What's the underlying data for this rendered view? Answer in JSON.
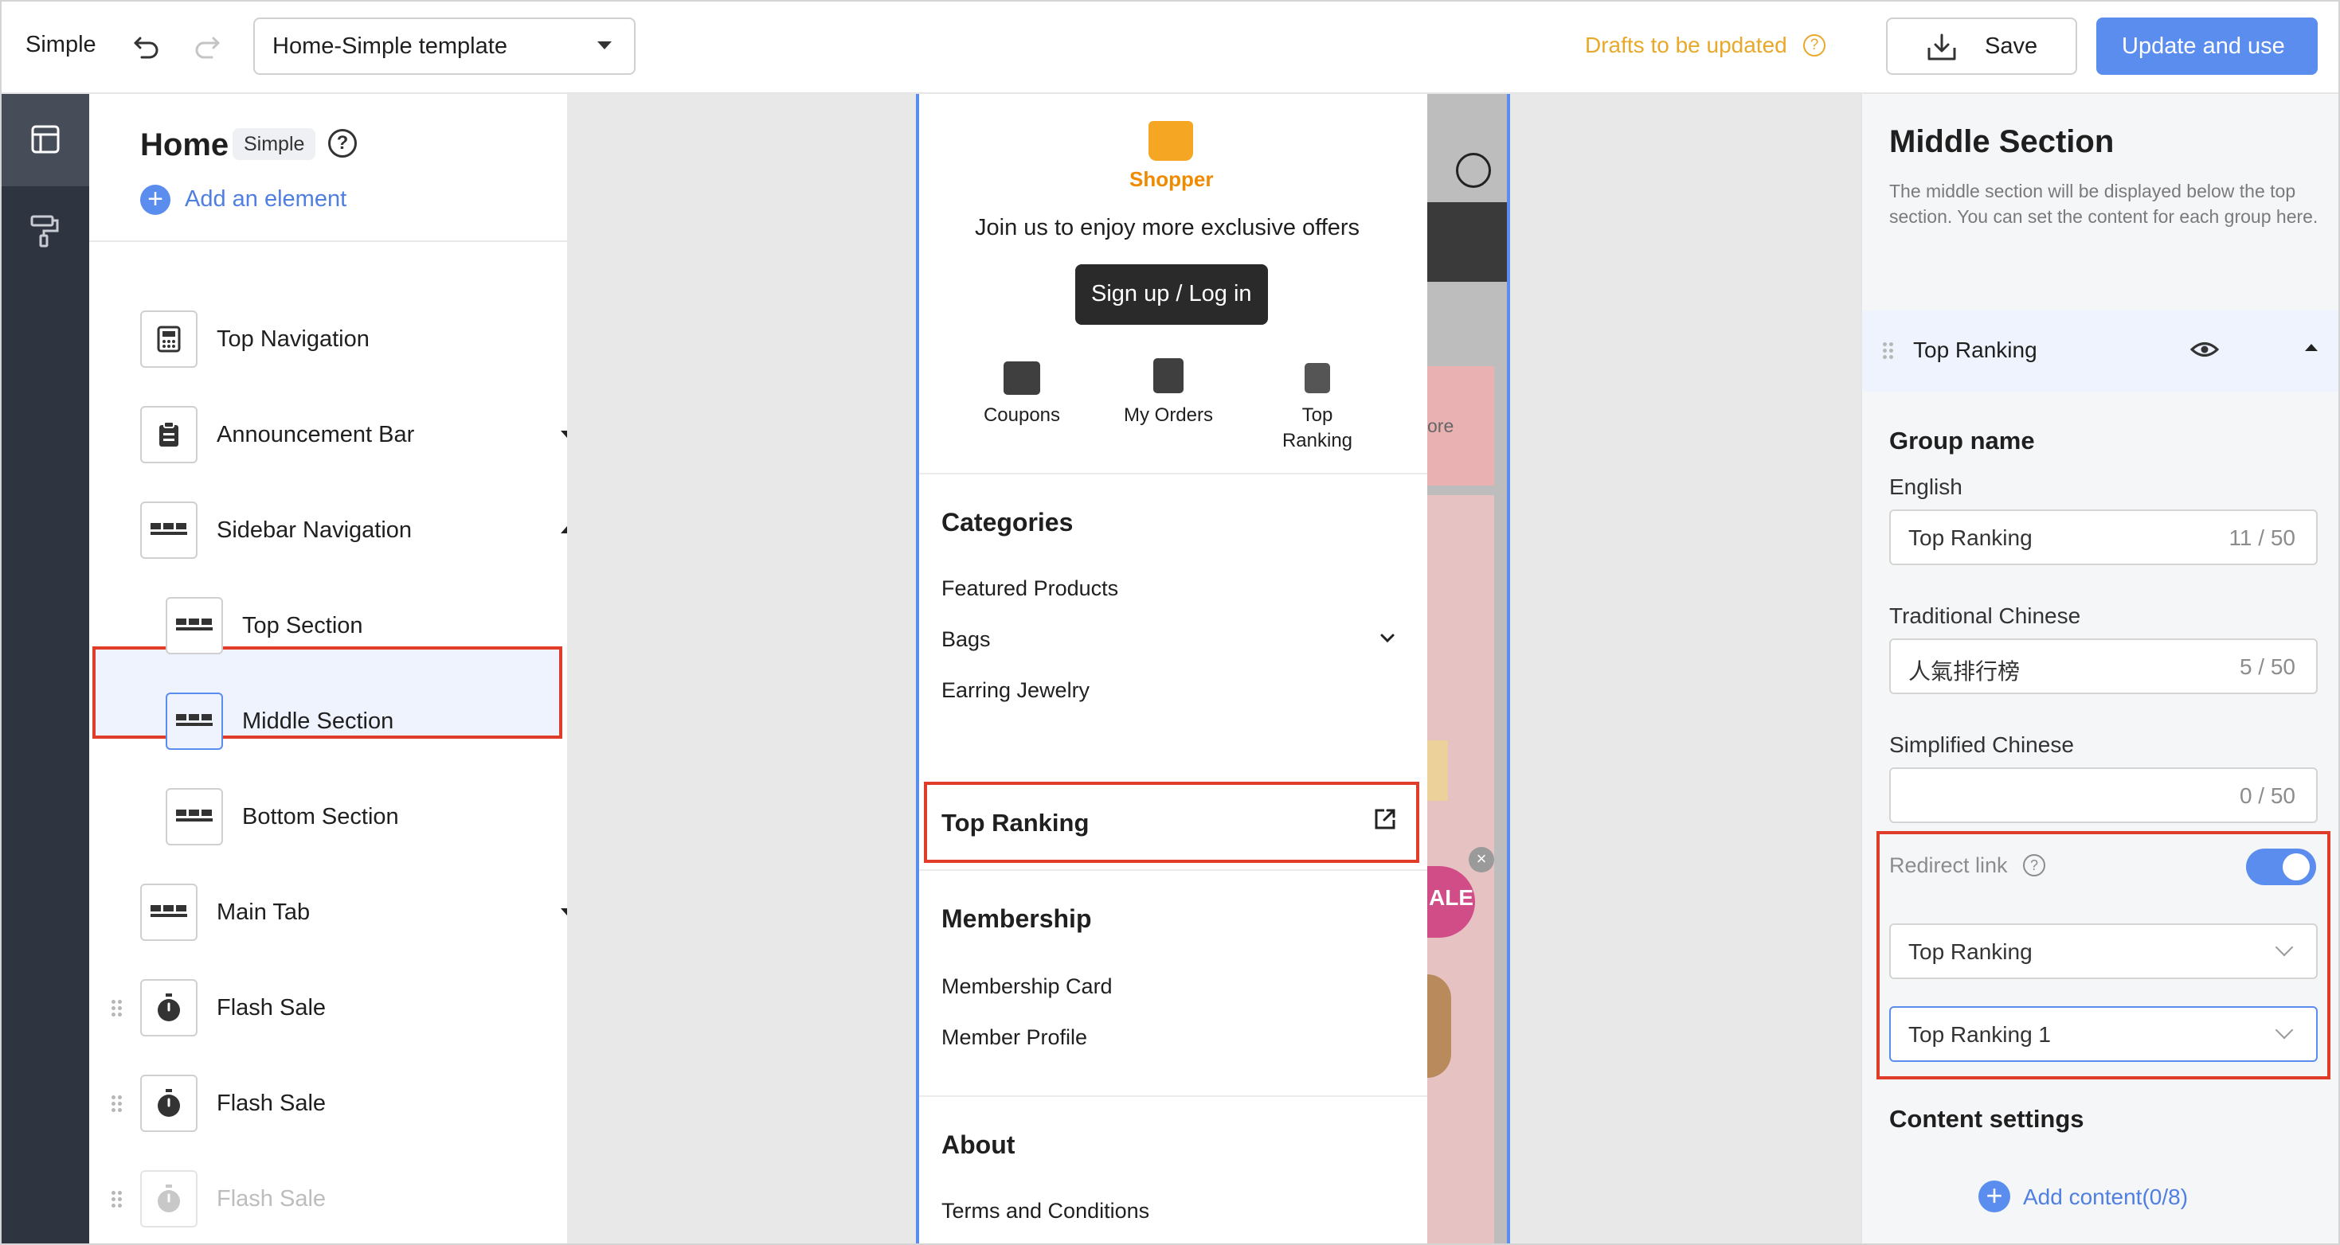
{
  "app": {
    "name": "Simple"
  },
  "toolbar": {
    "template_select": "Home-Simple template",
    "drafts_notice": "Drafts to be updated",
    "save_label": "Save",
    "update_label": "Update and use",
    "accent_color": "#5b8def",
    "warning_color": "#e8a92b"
  },
  "elements_panel": {
    "title": "Home",
    "badge": "Simple",
    "add_element": "Add an element",
    "items": [
      {
        "label": "Top Navigation",
        "icon": "calculator-icon"
      },
      {
        "label": "Announcement Bar",
        "icon": "clipboard-icon",
        "caret": "down"
      },
      {
        "label": "Sidebar Navigation",
        "icon": "grid-icon",
        "caret": "up"
      },
      {
        "label": "Top Section",
        "icon": "grid-icon"
      },
      {
        "label": "Middle Section",
        "icon": "grid-icon",
        "selected": true
      },
      {
        "label": "Bottom Section",
        "icon": "grid-icon"
      },
      {
        "label": "Main Tab",
        "icon": "grid-icon",
        "caret": "down"
      },
      {
        "label": "Flash Sale",
        "icon": "stopwatch-icon"
      },
      {
        "label": "Flash Sale",
        "icon": "stopwatch-icon"
      },
      {
        "label": "Flash Sale",
        "icon": "stopwatch-icon",
        "disabled": true
      }
    ]
  },
  "preview": {
    "shop_name": "Shopper",
    "join_text": "Join us to enjoy more exclusive offers",
    "signup_label": "Sign up / Log in",
    "quick_links": [
      "Coupons",
      "My Orders",
      "Top\nRanking"
    ],
    "categories": {
      "title": "Categories",
      "items": [
        "Featured Products",
        "Bags",
        "Earring Jewelry"
      ]
    },
    "top_ranking": "Top Ranking",
    "membership": {
      "title": "Membership",
      "items": [
        "Membership Card",
        "Member Profile"
      ]
    },
    "about": {
      "title": "About",
      "items": [
        "Terms and Conditions"
      ]
    },
    "background": {
      "more": "ore",
      "sale": "ALE"
    }
  },
  "settings": {
    "title": "Middle Section",
    "description": "The middle section will be displayed below the top section. You can set the content for each group here.",
    "group_header": "Top Ranking",
    "group_name_title": "Group name",
    "fields": [
      {
        "label": "English",
        "value": "Top Ranking",
        "count": "11 / 50"
      },
      {
        "label": "Traditional Chinese",
        "value": "人氣排行榜",
        "count": "5 / 50"
      },
      {
        "label": "Simplified Chinese",
        "value": "",
        "count": "0 / 50"
      }
    ],
    "redirect_label": "Redirect link",
    "redirect_enabled": true,
    "redirect_select_1": "Top Ranking",
    "redirect_select_2": "Top Ranking 1",
    "content_settings_title": "Content settings",
    "add_content": "Add content(0/8)"
  }
}
